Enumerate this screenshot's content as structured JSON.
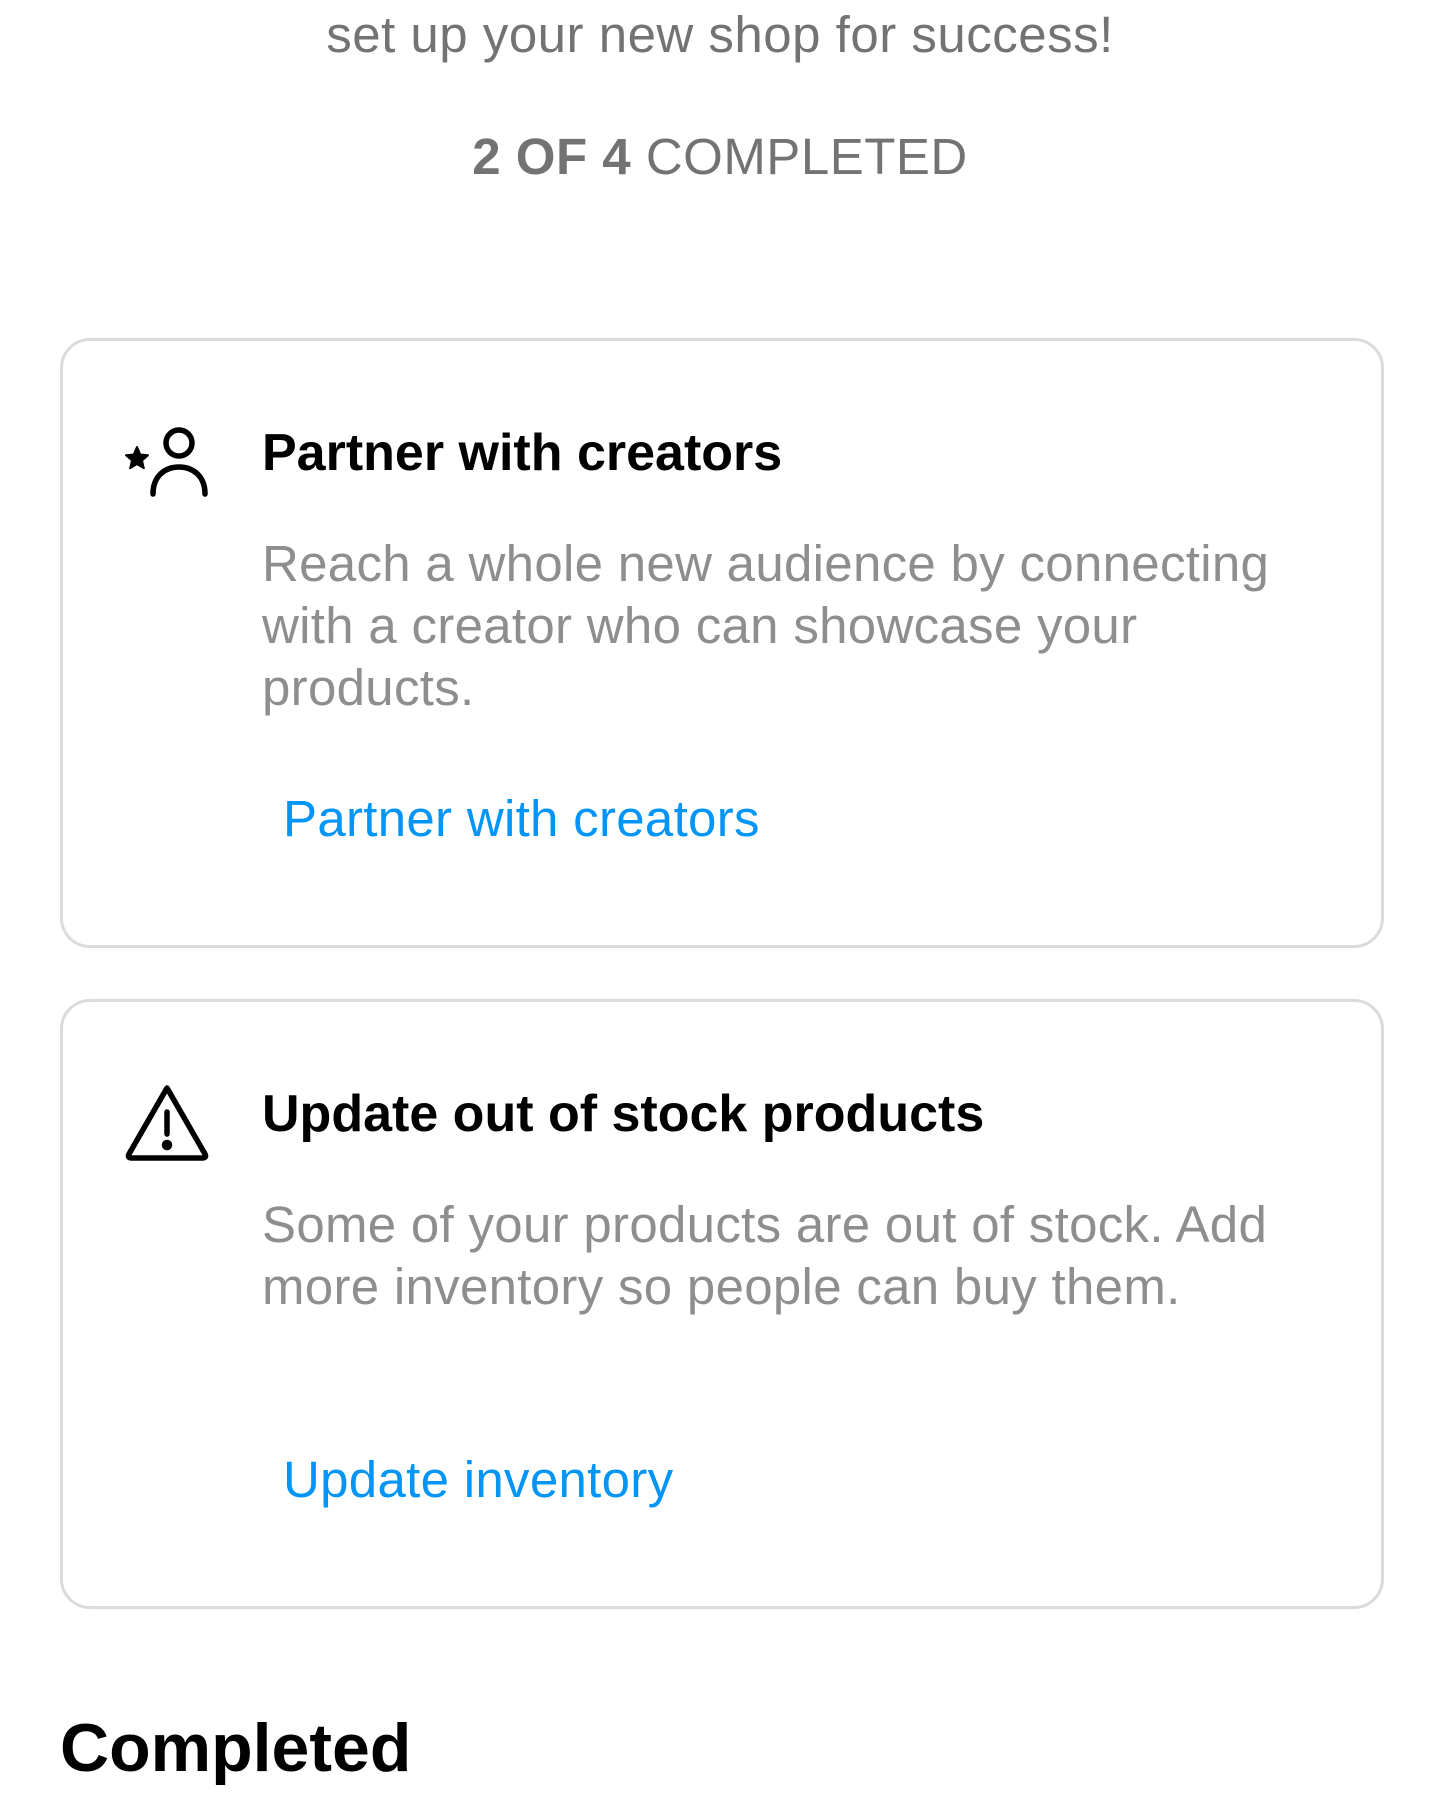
{
  "header": {
    "intro_text": "set up your new shop for success!",
    "progress_count": "2 OF 4",
    "progress_suffix": "COMPLETED"
  },
  "tasks": [
    {
      "icon": "person-star-icon",
      "title": "Partner with creators",
      "description": "Reach a whole new audience by connecting with a creator who can showcase your products.",
      "action_label": "Partner with creators"
    },
    {
      "icon": "warning-triangle-icon",
      "title": "Update out of stock products",
      "description": "Some of your products are out of stock. Add more inventory so people can buy them.",
      "action_label": "Update inventory"
    }
  ],
  "completed_section": {
    "heading": "Completed"
  },
  "colors": {
    "link": "#0095f6",
    "secondary_text": "#8e8e8e",
    "border": "#dbdbdb"
  }
}
